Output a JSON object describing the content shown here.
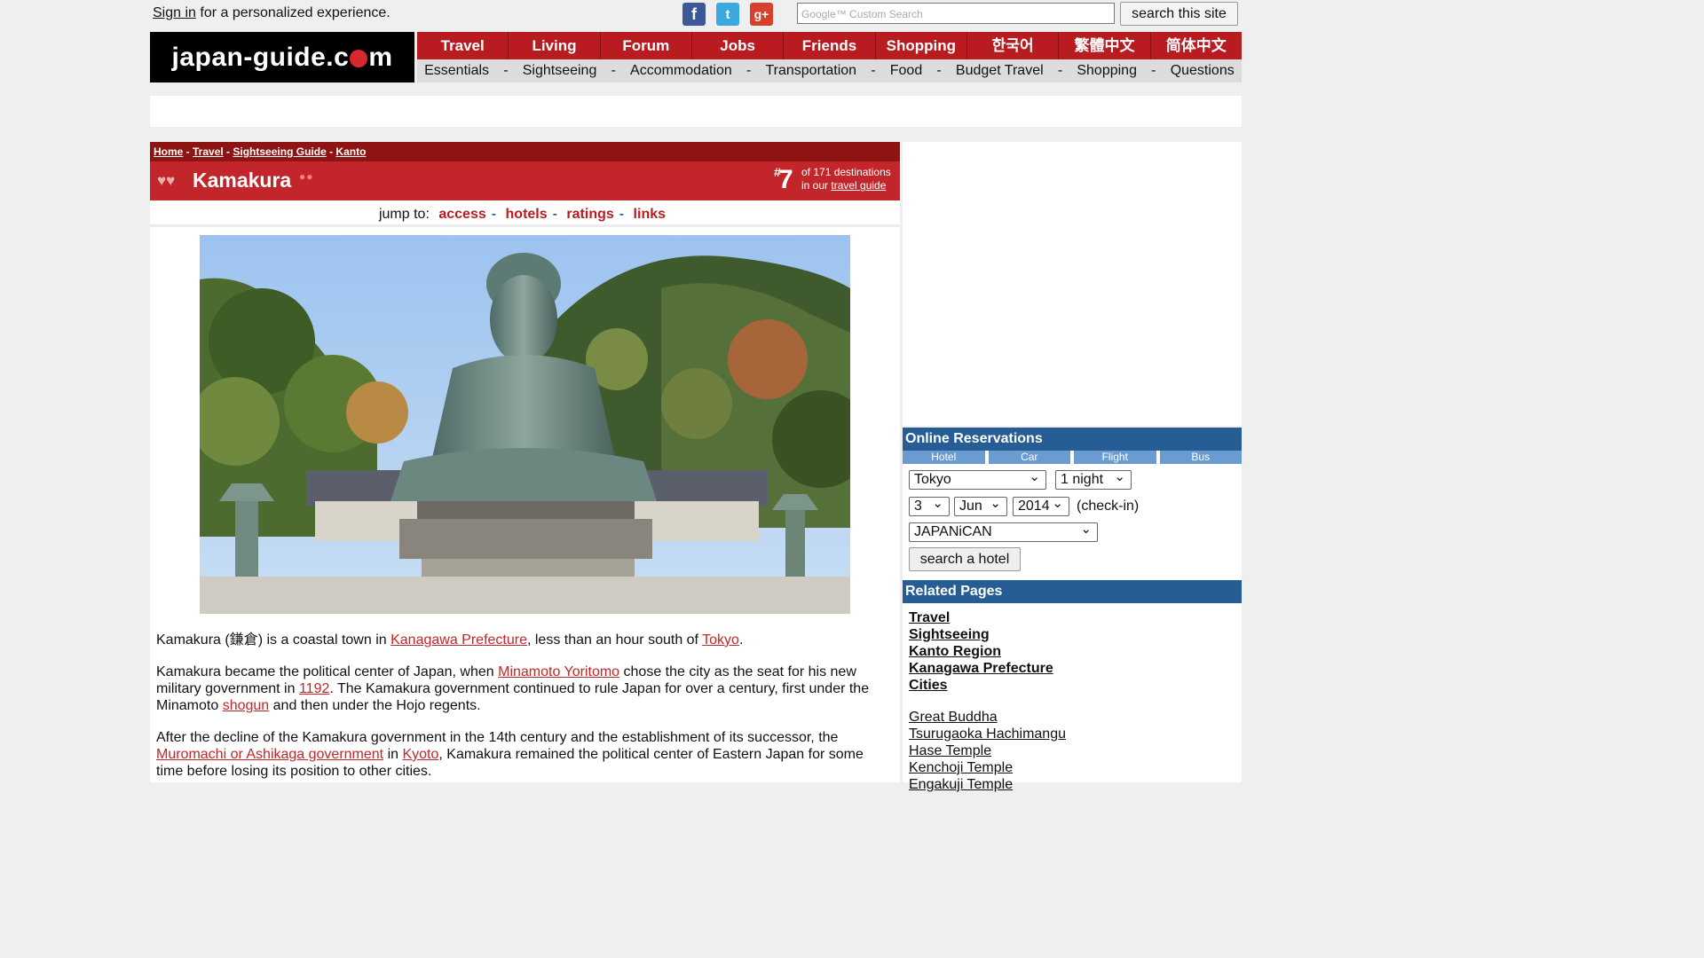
{
  "topbar": {
    "signin_link": "Sign in",
    "signin_rest": " for a personalized experience.",
    "social": [
      "facebook-icon",
      "twitter-icon",
      "googleplus-icon"
    ],
    "search_placeholder": "Google™ Custom Search",
    "search_button": "search this site"
  },
  "logo": {
    "before": "japan-guide.c",
    "after": "m"
  },
  "nav": {
    "main": [
      "Travel",
      "Living",
      "Forum",
      "Jobs",
      "Friends",
      "Shopping",
      "한국어",
      "繁體中文",
      "简体中文"
    ],
    "sub": [
      "Essentials",
      "Sightseeing",
      "Accommodation",
      "Transportation",
      "Food",
      "Budget Travel",
      "Shopping",
      "Questions"
    ]
  },
  "breadcrumb": [
    "Home",
    "Travel",
    "Sightseeing Guide",
    "Kanto"
  ],
  "page": {
    "title": "Kamakura",
    "rank_hash": "#",
    "rank_number": "7",
    "rank_line1": "of 171 destinations",
    "rank_line2_pre": "in our ",
    "rank_line2_link": "travel guide"
  },
  "jumpto": {
    "label": "jump to:",
    "links": [
      "access",
      "hotels",
      "ratings",
      "links"
    ]
  },
  "article": {
    "p1": {
      "a": "Kamakura (鎌倉) is a coastal town in ",
      "link1": "Kanagawa Prefecture",
      "b": ", less than an hour south of ",
      "link2": "Tokyo",
      "c": "."
    },
    "p2": {
      "a": "Kamakura became the political center of Japan, when ",
      "link1": "Minamoto Yoritomo",
      "b": " chose the city as the seat for his new military government in ",
      "link2": "1192",
      "c": ". The Kamakura government continued to rule Japan for over a century, first under the Minamoto ",
      "link3": "shogun",
      "d": " and then under the Hojo regents."
    },
    "p3": {
      "a": "After the decline of the Kamakura government in the 14th century and the establishment of its successor, the ",
      "link1": "Muromachi or Ashikaga government",
      "b": " in ",
      "link2": "Kyoto",
      "c": ", Kamakura remained the political center of Eastern Japan for some time before losing its position to other cities."
    }
  },
  "reservations": {
    "heading": "Online Reservations",
    "tabs": [
      "Hotel",
      "Car",
      "Flight",
      "Bus"
    ],
    "city": "Tokyo",
    "nights": "1 night",
    "day": "3",
    "month": "Jun",
    "year": "2014",
    "checkin_label": "(check-in)",
    "provider": "JAPANiCAN",
    "search_button": "search a hotel"
  },
  "related": {
    "heading": "Related Pages",
    "primary": [
      "Travel",
      "Sightseeing",
      "Kanto Region",
      "Kanagawa Prefecture",
      "Cities"
    ],
    "secondary": [
      "Great Buddha",
      "Tsurugaoka Hachimangu",
      "Hase Temple",
      "Kenchoji Temple",
      "Engakuji Temple"
    ]
  },
  "colors": {
    "brand_red": "#c3262a",
    "dark_red": "#8e1414",
    "side_blue": "#255d94",
    "tab_blue": "#6a9bd1"
  }
}
